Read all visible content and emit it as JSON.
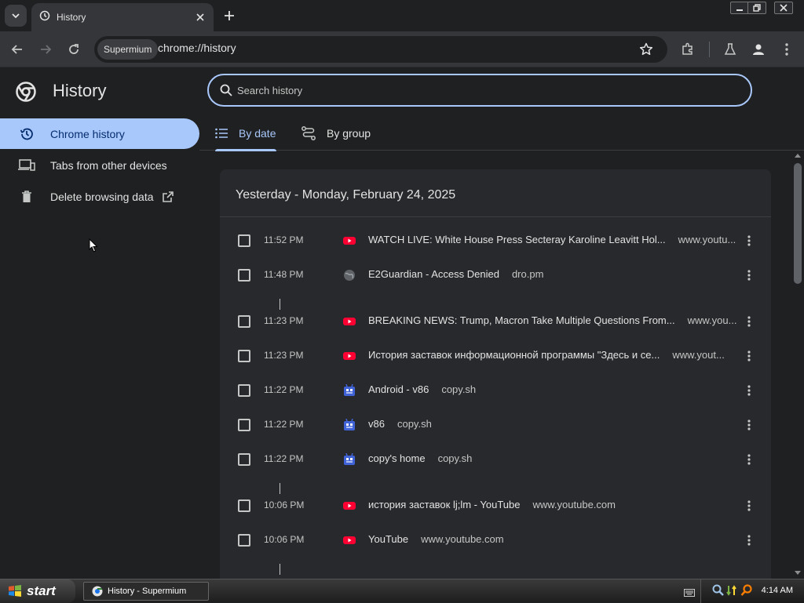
{
  "window": {
    "tab_title": "History",
    "controls": [
      "minimize",
      "restore",
      "close"
    ]
  },
  "toolbar": {
    "chip": "Supermium",
    "url": "chrome://history"
  },
  "sidebar": {
    "title": "History",
    "items": [
      {
        "label": "Chrome history",
        "icon": "history-icon",
        "active": true
      },
      {
        "label": "Tabs from other devices",
        "icon": "devices-icon",
        "active": false
      },
      {
        "label": "Delete browsing data",
        "icon": "trash-icon",
        "active": false
      }
    ]
  },
  "search": {
    "placeholder": "Search history"
  },
  "view_tabs": [
    {
      "label": "By date",
      "icon": "list-icon",
      "selected": true
    },
    {
      "label": "By group",
      "icon": "group-icon",
      "selected": false
    }
  ],
  "history": {
    "date_heading": "Yesterday - Monday, February 24, 2025",
    "entries": [
      {
        "time": "11:52 PM",
        "title": "WATCH LIVE: White House Press Secteray Karoline Leavitt Hol...",
        "domain": "www.youtu...",
        "favicon": "youtube"
      },
      {
        "time": "11:48 PM",
        "title": "E2Guardian - Access Denied",
        "domain": "dro.pm",
        "favicon": "globe"
      },
      {
        "time": "11:23 PM",
        "title": "BREAKING NEWS: Trump, Macron Take Multiple Questions From...",
        "domain": "www.you...",
        "favicon": "youtube"
      },
      {
        "time": "11:23 PM",
        "title": "История заставок информационной программы \"Здесь и се...",
        "domain": "www.yout...",
        "favicon": "youtube"
      },
      {
        "time": "11:22 PM",
        "title": "Android - v86",
        "domain": "copy.sh",
        "favicon": "copysh"
      },
      {
        "time": "11:22 PM",
        "title": "v86",
        "domain": "copy.sh",
        "favicon": "copysh"
      },
      {
        "time": "11:22 PM",
        "title": "copy's home",
        "domain": "copy.sh",
        "favicon": "copysh"
      },
      {
        "time": "10:06 PM",
        "title": "история заставок lj;lm - YouTube",
        "domain": "www.youtube.com",
        "favicon": "youtube"
      },
      {
        "time": "10:06 PM",
        "title": "YouTube",
        "domain": "www.youtube.com",
        "favicon": "youtube"
      }
    ]
  },
  "taskbar": {
    "start": "start",
    "task_label": "History - Supermium",
    "clock": "4:14 AM"
  },
  "colors": {
    "accent": "#a8c7fa",
    "background": "#1f2022",
    "card": "#28292c",
    "youtube": "#ff0033"
  }
}
